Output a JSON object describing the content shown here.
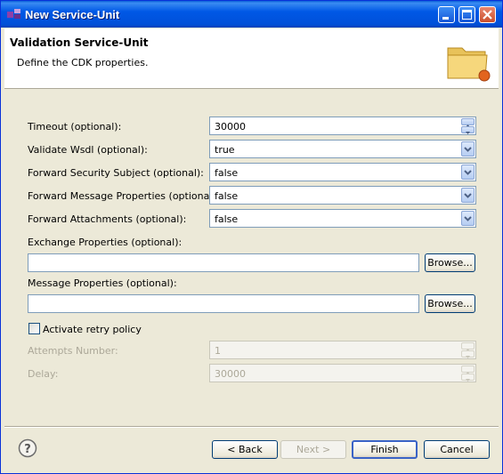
{
  "window": {
    "title": "New Service-Unit",
    "colors": {
      "titlebar": "#0058e6",
      "close": "#c94f2c",
      "dialog_bg": "#ece9d8"
    }
  },
  "header": {
    "title": "Validation Service-Unit",
    "description": "Define the CDK properties.",
    "icon": "folder-icon"
  },
  "form": {
    "timeout": {
      "label": "Timeout (optional):",
      "value": "30000"
    },
    "validate_wsdl": {
      "label": "Validate Wsdl (optional):",
      "value": "true"
    },
    "forward_security_subject": {
      "label": "Forward Security Subject (optional):",
      "value": "false"
    },
    "forward_message_properties": {
      "label": "Forward Message Properties (optional):",
      "value": "false"
    },
    "forward_attachments": {
      "label": "Forward Attachments (optional):",
      "value": "false"
    },
    "exchange_properties": {
      "label": "Exchange Properties (optional):",
      "value": "",
      "browse_label": "Browse..."
    },
    "message_properties": {
      "label": "Message Properties (optional):",
      "value": "",
      "browse_label": "Browse..."
    },
    "retry": {
      "label": "Activate retry policy",
      "checked": false
    },
    "attempts": {
      "label": "Attempts Number:",
      "value": "1"
    },
    "delay": {
      "label": "Delay:",
      "value": "30000"
    }
  },
  "footer": {
    "back_label": "< Back",
    "next_label": "Next >",
    "finish_label": "Finish",
    "cancel_label": "Cancel"
  }
}
